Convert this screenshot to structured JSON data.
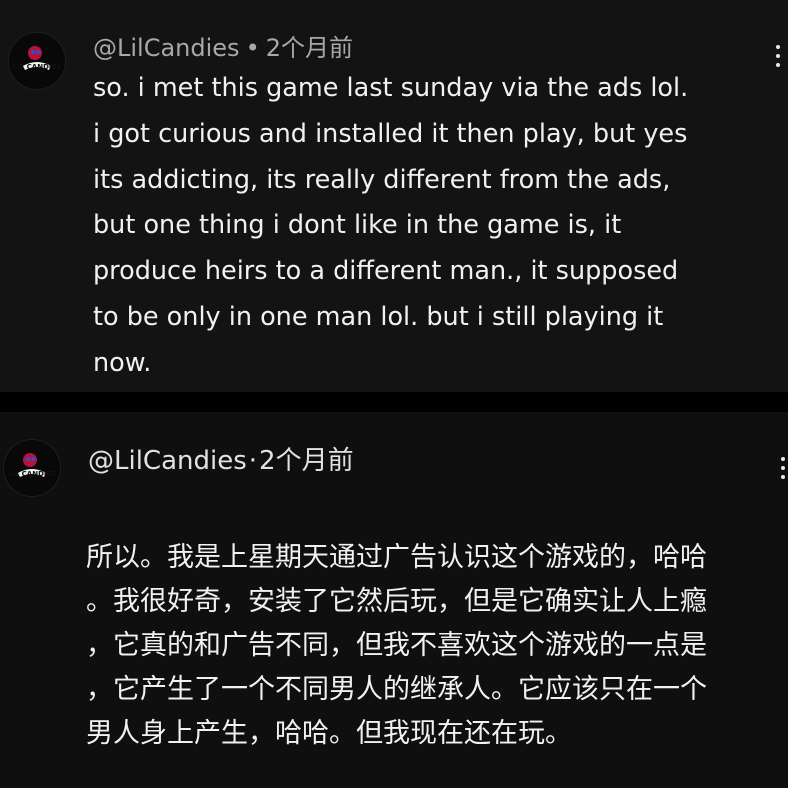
{
  "comments": [
    {
      "handle": "@LilCandies",
      "separator": "•",
      "time": "2个月前",
      "avatar_text": "LIL CANDIES",
      "text": "so. i met this game last sunday via the ads lol.\ni got curious and installed it then play, but yes\nits addicting, its really different from the ads,\nbut one thing i dont like in the game is, it\nproduce heirs to a different man., it supposed\nto be only in one man lol. but i still playing it\nnow.",
      "menu_icon": "more-vertical-icon"
    },
    {
      "handle": "@LilCandies",
      "separator": "·",
      "time": "2个月前",
      "avatar_text": "LIL CANDIES",
      "text": "所以。我是上星期天通过广告认识这个游戏的，哈哈\n。我很好奇，安装了它然后玩，但是它确实让人上瘾\n，它真的和广告不同，但我不喜欢这个游戏的一点是\n，它产生了一个不同男人的继承人。它应该只在一个\n男人身上产生，哈哈。但我现在还在玩。",
      "menu_icon": "more-vertical-icon"
    }
  ],
  "colors": {
    "background": "#000000",
    "card_1": "#131313",
    "card_2": "#0f0f0f",
    "text_primary": "#f1f1f1",
    "text_meta": "#a8a8a8"
  }
}
